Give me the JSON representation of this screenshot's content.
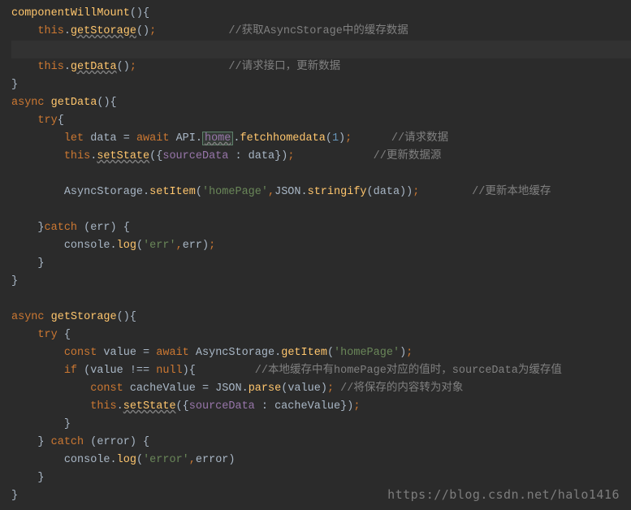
{
  "editor": {
    "lines": [
      {
        "indent": 0,
        "tokens": [
          {
            "t": "componentWillMount",
            "c": "t-funcdef"
          },
          {
            "t": "()",
            "c": "t-paren"
          },
          {
            "t": "{",
            "c": "t-brace"
          }
        ]
      },
      {
        "indent": 1,
        "tokens": [
          {
            "t": "this",
            "c": "t-this"
          },
          {
            "t": ".",
            "c": "t-default"
          },
          {
            "t": "getStorage",
            "c": "t-wavy"
          },
          {
            "t": "()",
            "c": "t-paren"
          },
          {
            "t": ";",
            "c": "t-punct"
          }
        ],
        "comment_col": 33,
        "comment": "//获取AsyncStorage中的缓存数据"
      },
      {
        "hl": true,
        "indent": 0,
        "tokens": []
      },
      {
        "indent": 1,
        "tokens": [
          {
            "t": "this",
            "c": "t-this"
          },
          {
            "t": ".",
            "c": "t-default"
          },
          {
            "t": "getData",
            "c": "t-wavy"
          },
          {
            "t": "()",
            "c": "t-paren"
          },
          {
            "t": ";",
            "c": "t-punct"
          }
        ],
        "comment_col": 33,
        "comment": "//请求接口，更新数据"
      },
      {
        "indent": 0,
        "tokens": [
          {
            "t": "}",
            "c": "t-brace"
          }
        ]
      },
      {
        "indent": 0,
        "tokens": [
          {
            "t": "async",
            "c": "t-keyword"
          },
          {
            "t": " ",
            "c": "t-default"
          },
          {
            "t": "getData",
            "c": "t-funcdef"
          },
          {
            "t": "()",
            "c": "t-paren"
          },
          {
            "t": "{",
            "c": "t-brace"
          }
        ]
      },
      {
        "indent": 1,
        "tokens": [
          {
            "t": "try",
            "c": "t-keyword"
          },
          {
            "t": "{",
            "c": "t-brace"
          }
        ]
      },
      {
        "indent": 2,
        "tokens": [
          {
            "t": "let",
            "c": "t-keyword"
          },
          {
            "t": " data ",
            "c": "t-default"
          },
          {
            "t": "=",
            "c": "t-default"
          },
          {
            "t": " ",
            "c": "t-default"
          },
          {
            "t": "await",
            "c": "t-keyword"
          },
          {
            "t": " API",
            "c": "t-default"
          },
          {
            "t": ".",
            "c": "t-default"
          },
          {
            "t": "home",
            "c": "t-propw",
            "boxed": true
          },
          {
            "t": ".",
            "c": "t-default"
          },
          {
            "t": "fetchhomedata",
            "c": "t-func"
          },
          {
            "t": "(",
            "c": "t-paren"
          },
          {
            "t": "1",
            "c": "t-num"
          },
          {
            "t": ")",
            "c": "t-paren"
          },
          {
            "t": ";",
            "c": "t-punct"
          }
        ],
        "comment_col": 57,
        "comment": "//请求数据"
      },
      {
        "indent": 2,
        "tokens": [
          {
            "t": "this",
            "c": "t-this"
          },
          {
            "t": ".",
            "c": "t-default"
          },
          {
            "t": "setState",
            "c": "t-wavy"
          },
          {
            "t": "(",
            "c": "t-paren"
          },
          {
            "t": "{",
            "c": "t-brace"
          },
          {
            "t": "sourceData",
            "c": "t-prop"
          },
          {
            "t": " : data",
            "c": "t-default"
          },
          {
            "t": "}",
            "c": "t-brace"
          },
          {
            "t": ")",
            "c": "t-paren"
          },
          {
            "t": ";",
            "c": "t-punct"
          }
        ],
        "comment_col": 55,
        "comment": "//更新数据源"
      },
      {
        "indent": 0,
        "tokens": []
      },
      {
        "indent": 2,
        "tokens": [
          {
            "t": "AsyncStorage",
            "c": "t-default"
          },
          {
            "t": ".",
            "c": "t-default"
          },
          {
            "t": "setItem",
            "c": "t-func"
          },
          {
            "t": "(",
            "c": "t-paren"
          },
          {
            "t": "'homePage'",
            "c": "t-string"
          },
          {
            "t": ",",
            "c": "t-punct"
          },
          {
            "t": "JSON",
            "c": "t-default"
          },
          {
            "t": ".",
            "c": "t-default"
          },
          {
            "t": "stringify",
            "c": "t-func"
          },
          {
            "t": "(",
            "c": "t-paren"
          },
          {
            "t": "data",
            "c": "t-default"
          },
          {
            "t": "))",
            "c": "t-paren"
          },
          {
            "t": ";",
            "c": "t-punct"
          }
        ],
        "comment_col": 70,
        "comment": "//更新本地缓存"
      },
      {
        "indent": 0,
        "tokens": []
      },
      {
        "indent": 1,
        "tokens": [
          {
            "t": "}",
            "c": "t-brace"
          },
          {
            "t": "catch",
            "c": "t-keyword"
          },
          {
            "t": " (err) {",
            "c": "t-default"
          }
        ]
      },
      {
        "indent": 2,
        "tokens": [
          {
            "t": "console",
            "c": "t-default"
          },
          {
            "t": ".",
            "c": "t-default"
          },
          {
            "t": "log",
            "c": "t-func"
          },
          {
            "t": "(",
            "c": "t-paren"
          },
          {
            "t": "'err'",
            "c": "t-string"
          },
          {
            "t": ",",
            "c": "t-punct"
          },
          {
            "t": "err",
            "c": "t-default"
          },
          {
            "t": ")",
            "c": "t-paren"
          },
          {
            "t": ";",
            "c": "t-punct"
          }
        ]
      },
      {
        "indent": 1,
        "tokens": [
          {
            "t": "}",
            "c": "t-brace"
          }
        ]
      },
      {
        "indent": 0,
        "tokens": [
          {
            "t": "}",
            "c": "t-brace"
          }
        ]
      },
      {
        "indent": 0,
        "tokens": []
      },
      {
        "indent": 0,
        "tokens": [
          {
            "t": "async",
            "c": "t-keyword"
          },
          {
            "t": " ",
            "c": "t-default"
          },
          {
            "t": "getStorage",
            "c": "t-funcdef"
          },
          {
            "t": "()",
            "c": "t-paren"
          },
          {
            "t": "{",
            "c": "t-brace"
          }
        ]
      },
      {
        "indent": 1,
        "tokens": [
          {
            "t": "try",
            "c": "t-keyword"
          },
          {
            "t": " {",
            "c": "t-default"
          }
        ]
      },
      {
        "indent": 2,
        "tokens": [
          {
            "t": "const",
            "c": "t-keyword"
          },
          {
            "t": " value ",
            "c": "t-default"
          },
          {
            "t": "=",
            "c": "t-default"
          },
          {
            "t": " ",
            "c": "t-default"
          },
          {
            "t": "await",
            "c": "t-keyword"
          },
          {
            "t": " ",
            "c": "t-default"
          },
          {
            "t": "AsyncStorage",
            "c": "t-default"
          },
          {
            "t": ".",
            "c": "t-default"
          },
          {
            "t": "getItem",
            "c": "t-func"
          },
          {
            "t": "(",
            "c": "t-paren"
          },
          {
            "t": "'homePage'",
            "c": "t-string"
          },
          {
            "t": ")",
            "c": "t-paren"
          },
          {
            "t": ";",
            "c": "t-punct"
          }
        ]
      },
      {
        "indent": 2,
        "tokens": [
          {
            "t": "if",
            "c": "t-keyword"
          },
          {
            "t": " (value ",
            "c": "t-default"
          },
          {
            "t": "!==",
            "c": "t-default"
          },
          {
            "t": " ",
            "c": "t-default"
          },
          {
            "t": "null",
            "c": "t-null"
          },
          {
            "t": ")",
            "c": "t-paren"
          },
          {
            "t": "{",
            "c": "t-brace"
          }
        ],
        "comment_col": 37,
        "comment": "//本地缓存中有homePage对应的值时，sourceData为缓存值"
      },
      {
        "indent": 3,
        "tokens": [
          {
            "t": "const",
            "c": "t-keyword"
          },
          {
            "t": " cacheValue ",
            "c": "t-default"
          },
          {
            "t": "=",
            "c": "t-default"
          },
          {
            "t": " JSON",
            "c": "t-default"
          },
          {
            "t": ".",
            "c": "t-default"
          },
          {
            "t": "parse",
            "c": "t-func"
          },
          {
            "t": "(",
            "c": "t-paren"
          },
          {
            "t": "value",
            "c": "t-default"
          },
          {
            "t": ")",
            "c": "t-paren"
          },
          {
            "t": ";",
            "c": "t-punct"
          }
        ],
        "comment_col": 50,
        "comment": "//将保存的内容转为对象"
      },
      {
        "indent": 3,
        "tokens": [
          {
            "t": "this",
            "c": "t-this"
          },
          {
            "t": ".",
            "c": "t-default"
          },
          {
            "t": "setState",
            "c": "t-wavy"
          },
          {
            "t": "(",
            "c": "t-paren"
          },
          {
            "t": "{",
            "c": "t-brace"
          },
          {
            "t": "sourceData",
            "c": "t-prop"
          },
          {
            "t": " : cacheValue",
            "c": "t-default"
          },
          {
            "t": "}",
            "c": "t-brace"
          },
          {
            "t": ")",
            "c": "t-paren"
          },
          {
            "t": ";",
            "c": "t-punct"
          }
        ]
      },
      {
        "indent": 2,
        "tokens": [
          {
            "t": "}",
            "c": "t-brace"
          }
        ]
      },
      {
        "indent": 1,
        "tokens": [
          {
            "t": "}",
            "c": "t-brace"
          },
          {
            "t": " ",
            "c": "t-default"
          },
          {
            "t": "catch",
            "c": "t-keyword"
          },
          {
            "t": " (error) {",
            "c": "t-default"
          }
        ]
      },
      {
        "indent": 2,
        "tokens": [
          {
            "t": "console",
            "c": "t-default"
          },
          {
            "t": ".",
            "c": "t-default"
          },
          {
            "t": "log",
            "c": "t-func"
          },
          {
            "t": "(",
            "c": "t-paren"
          },
          {
            "t": "'error'",
            "c": "t-string"
          },
          {
            "t": ",",
            "c": "t-punct"
          },
          {
            "t": "error",
            "c": "t-default"
          },
          {
            "t": ")",
            "c": "t-paren"
          }
        ]
      },
      {
        "indent": 1,
        "tokens": [
          {
            "t": "}",
            "c": "t-brace"
          }
        ]
      },
      {
        "indent": 0,
        "tokens": [
          {
            "t": "}",
            "c": "t-brace"
          }
        ]
      }
    ]
  },
  "watermark": "https://blog.csdn.net/halo1416"
}
